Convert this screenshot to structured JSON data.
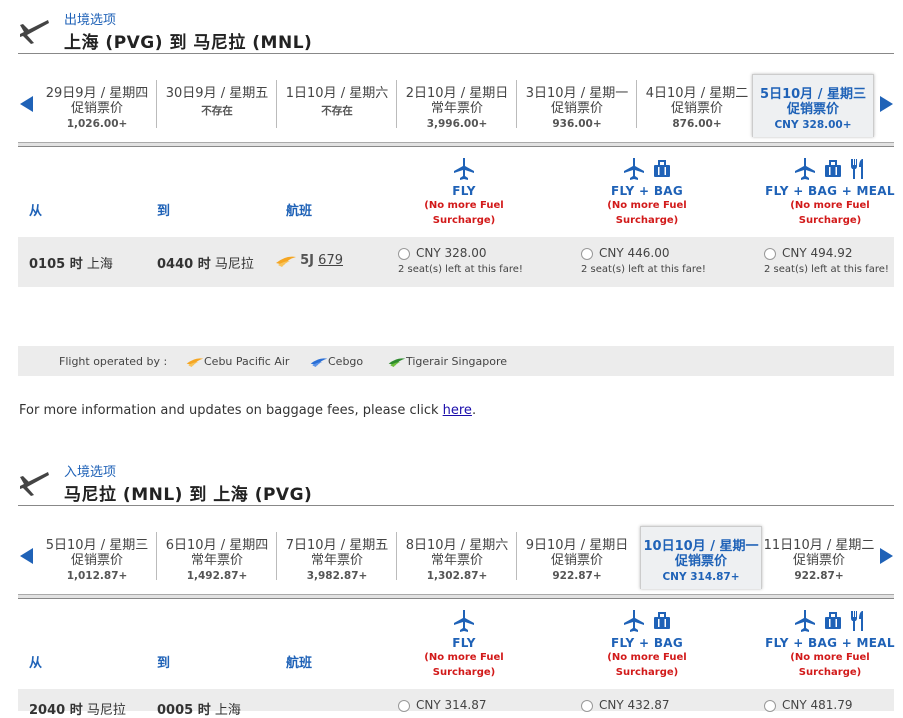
{
  "outbound": {
    "label": "出境选项",
    "route": "上海 (PVG) 到 马尼拉 (MNL)",
    "dates": [
      {
        "date": "29日9月 / 星期四",
        "fare_type": "促销票价",
        "price": "1,026.00+"
      },
      {
        "date": "30日9月 / 星期五",
        "fare_type": "",
        "price": "不存在"
      },
      {
        "date": "1日10月 / 星期六",
        "fare_type": "",
        "price": "不存在"
      },
      {
        "date": "2日10月 / 星期日",
        "fare_type": "常年票价",
        "price": "3,996.00+"
      },
      {
        "date": "3日10月 / 星期一",
        "fare_type": "促销票价",
        "price": "936.00+"
      },
      {
        "date": "4日10月 / 星期二",
        "fare_type": "促销票价",
        "price": "876.00+"
      },
      {
        "date": "5日10月 / 星期三",
        "fare_type": "促销票价",
        "price": "CNY 328.00+"
      }
    ],
    "selected_index": 6,
    "columns": {
      "from": "从",
      "to": "到",
      "flight": "航班"
    },
    "fares": [
      {
        "name": "FLY",
        "note1": "(No more Fuel",
        "note2": "Surcharge)",
        "icons": [
          "plane-icon"
        ]
      },
      {
        "name": "FLY + BAG",
        "note1": "(No more Fuel",
        "note2": "Surcharge)",
        "icons": [
          "plane-icon",
          "baggage-icon"
        ]
      },
      {
        "name": "FLY + BAG + MEAL",
        "note1": "(No more Fuel",
        "note2": "Surcharge)",
        "icons": [
          "plane-icon",
          "baggage-icon",
          "meal-icon"
        ]
      }
    ],
    "flight": {
      "dep_time": "0105 时",
      "dep_city": "上海",
      "arr_time": "0440 时",
      "arr_city": "马尼拉",
      "airline_code": "5J",
      "flight_no": "679",
      "prices": [
        {
          "price": "CNY 328.00",
          "seats": "2 seat(s) left at this fare!"
        },
        {
          "price": "CNY 446.00",
          "seats": "2 seat(s) left at this fare!"
        },
        {
          "price": "CNY 494.92",
          "seats": "2 seat(s) left at this fare!"
        }
      ]
    }
  },
  "operators": {
    "label": "Flight operated by :",
    "items": [
      {
        "name": "Cebu Pacific Air",
        "color": "#f5a623"
      },
      {
        "name": "Cebgo",
        "color": "#2a6fd6"
      },
      {
        "name": "Tigerair Singapore",
        "color": "#2e8b2e"
      }
    ]
  },
  "info": {
    "text": "For more information and updates on baggage fees, please click ",
    "link": "here",
    "end": "."
  },
  "inbound": {
    "label": "入境选项",
    "route": "马尼拉 (MNL) 到 上海 (PVG)",
    "dates": [
      {
        "date": "5日10月 / 星期三",
        "fare_type": "促销票价",
        "price": "1,012.87+"
      },
      {
        "date": "6日10月 / 星期四",
        "fare_type": "常年票价",
        "price": "1,492.87+"
      },
      {
        "date": "7日10月 / 星期五",
        "fare_type": "常年票价",
        "price": "3,982.87+"
      },
      {
        "date": "8日10月 / 星期六",
        "fare_type": "常年票价",
        "price": "1,302.87+"
      },
      {
        "date": "9日10月 / 星期日",
        "fare_type": "促销票价",
        "price": "922.87+"
      },
      {
        "date": "10日10月 / 星期一",
        "fare_type": "促销票价",
        "price": "CNY 314.87+"
      },
      {
        "date": "11日10月 / 星期二",
        "fare_type": "促销票价",
        "price": "922.87+"
      }
    ],
    "selected_index": 5,
    "columns": {
      "from": "从",
      "to": "到",
      "flight": "航班"
    },
    "fares": [
      {
        "name": "FLY",
        "note1": "(No more Fuel",
        "note2": "Surcharge)",
        "icons": [
          "plane-icon"
        ]
      },
      {
        "name": "FLY + BAG",
        "note1": "(No more Fuel",
        "note2": "Surcharge)",
        "icons": [
          "plane-icon",
          "baggage-icon"
        ]
      },
      {
        "name": "FLY + BAG + MEAL",
        "note1": "(No more Fuel",
        "note2": "Surcharge)",
        "icons": [
          "plane-icon",
          "baggage-icon",
          "meal-icon"
        ]
      }
    ],
    "flight": {
      "dep_time": "2040 时",
      "dep_city": "马尼拉",
      "arr_time": "0005 时",
      "arr_city": "上海",
      "prices": [
        {
          "price": "CNY 314.87"
        },
        {
          "price": "CNY 432.87"
        },
        {
          "price": "CNY 481.79"
        }
      ]
    }
  },
  "colors": {
    "accent": "#1f62b7",
    "alert": "#d21a1a",
    "row_bg": "#ececec"
  }
}
